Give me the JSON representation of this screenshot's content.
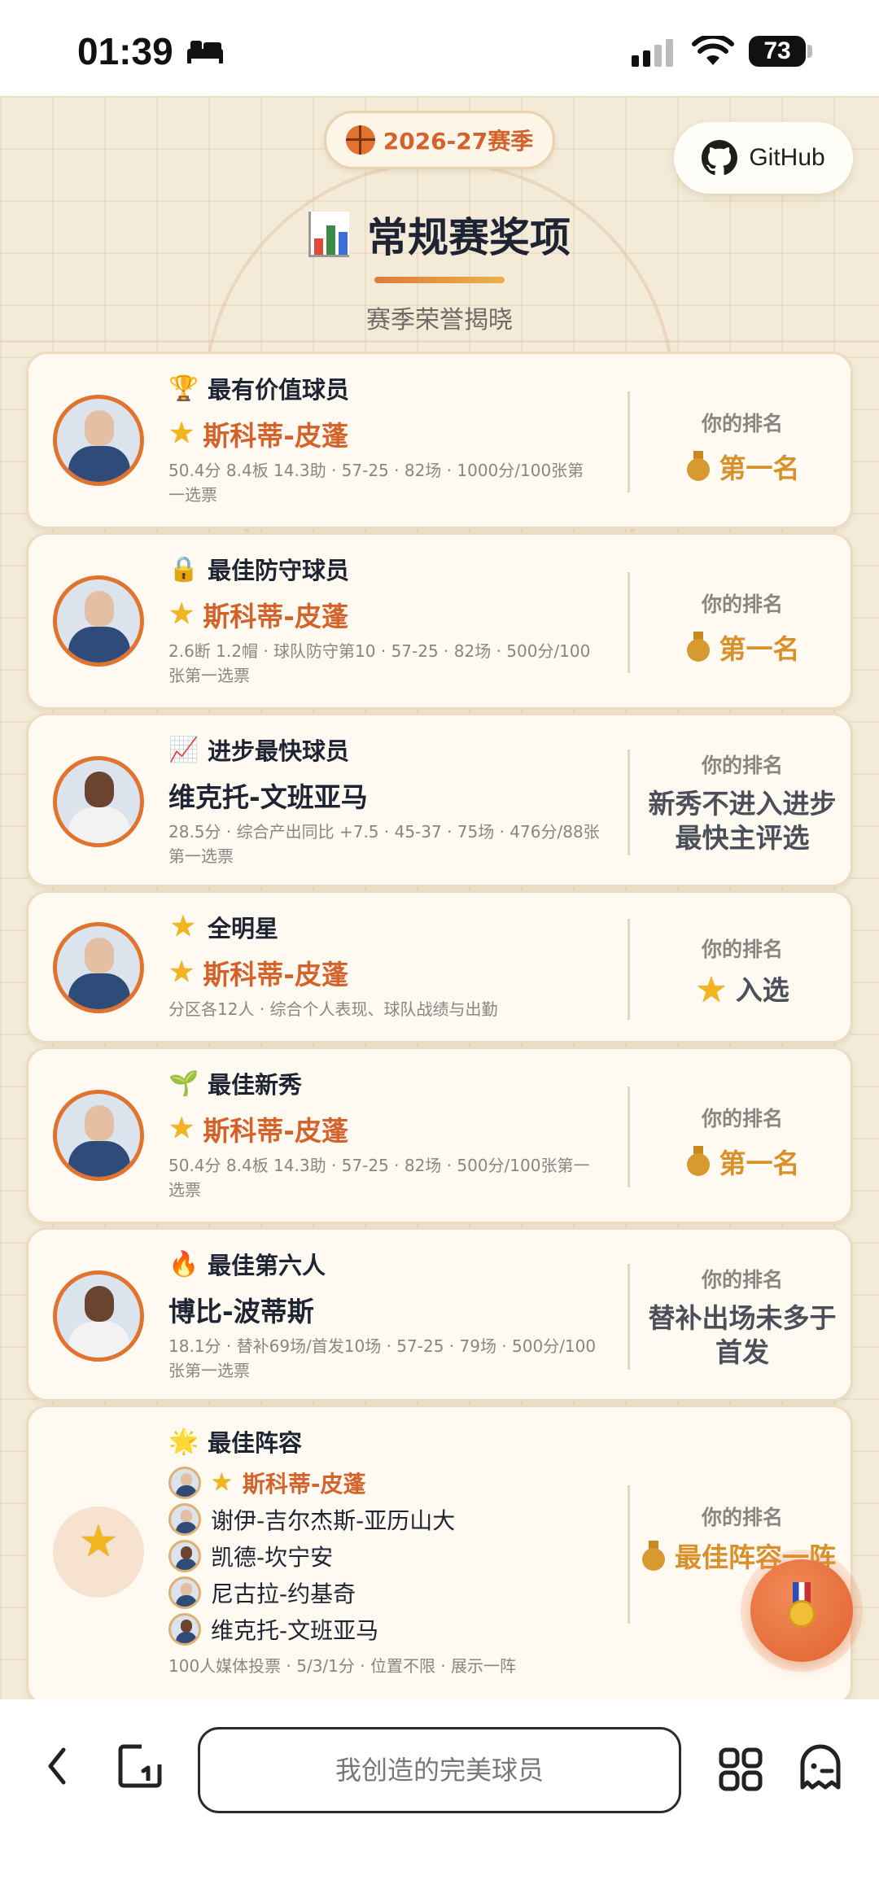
{
  "status_bar": {
    "time": "01:39",
    "battery": "73",
    "icons": [
      "bed-icon",
      "signal-icon",
      "wifi-icon",
      "battery-icon"
    ]
  },
  "header": {
    "season": "2026-27赛季",
    "github_label": "GitHub",
    "title": "常规赛奖项",
    "subtitle": "赛季荣誉揭晓"
  },
  "rank_label": "你的排名",
  "awards": [
    {
      "icon": "trophy-icon",
      "glyph": "🏆",
      "award": "最有价值球员",
      "player": "斯科蒂-皮蓬",
      "stats": "50.4分 8.4板 14.3助 · 57-25 · 82场 · 1000分/100张第一选票",
      "rank": "第一名"
    },
    {
      "icon": "lock-icon",
      "glyph": "🔒",
      "award": "最佳防守球员",
      "player": "斯科蒂-皮蓬",
      "stats": "2.6断 1.2帽 · 球队防守第10 · 57-25 · 82场 · 500分/100张第一选票",
      "rank": "第一名"
    },
    {
      "icon": "chart-up-icon",
      "glyph": "📈",
      "award": "进步最快球员",
      "player": "维克托-文班亚马",
      "stats": "28.5分 · 综合产出同比 +7.5 · 45-37 · 75场 · 476分/88张第一选票",
      "rank": "新秀不进入进步最快主评选"
    },
    {
      "icon": "star-icon",
      "glyph": "⭐",
      "award": "全明星",
      "player": "斯科蒂-皮蓬",
      "stats": "分区各12人 · 综合个人表现、球队战绩与出勤",
      "rank": "入选"
    },
    {
      "icon": "seedling-icon",
      "glyph": "🌱",
      "award": "最佳新秀",
      "player": "斯科蒂-皮蓬",
      "stats": "50.4分 8.4板 14.3助 · 57-25 · 82场 · 500分/100张第一选票",
      "rank": "第一名"
    },
    {
      "icon": "fire-icon",
      "glyph": "🔥",
      "award": "最佳第六人",
      "player": "博比-波蒂斯",
      "stats": "18.1分 · 替补69场/首发10场 · 57-25 · 79场 · 500分/100张第一选票",
      "rank": "替补出场未多于首发"
    },
    {
      "icon": "sparkle-star-icon",
      "glyph": "🌟",
      "award": "最佳阵容",
      "team": [
        "斯科蒂-皮蓬",
        "谢伊-吉尔杰斯-亚历山大",
        "凯德-坎宁安",
        "尼古拉-约基奇",
        "维克托-文班亚马"
      ],
      "stats": "100人媒体投票 · 5/3/1分 · 位置不限 · 展示一阵",
      "rank": "最佳阵容一阵"
    }
  ],
  "browser": {
    "url_text": "我创造的完美球员",
    "icons": [
      "back-icon",
      "tab-icon",
      "grid-icon",
      "ghost-icon"
    ]
  }
}
